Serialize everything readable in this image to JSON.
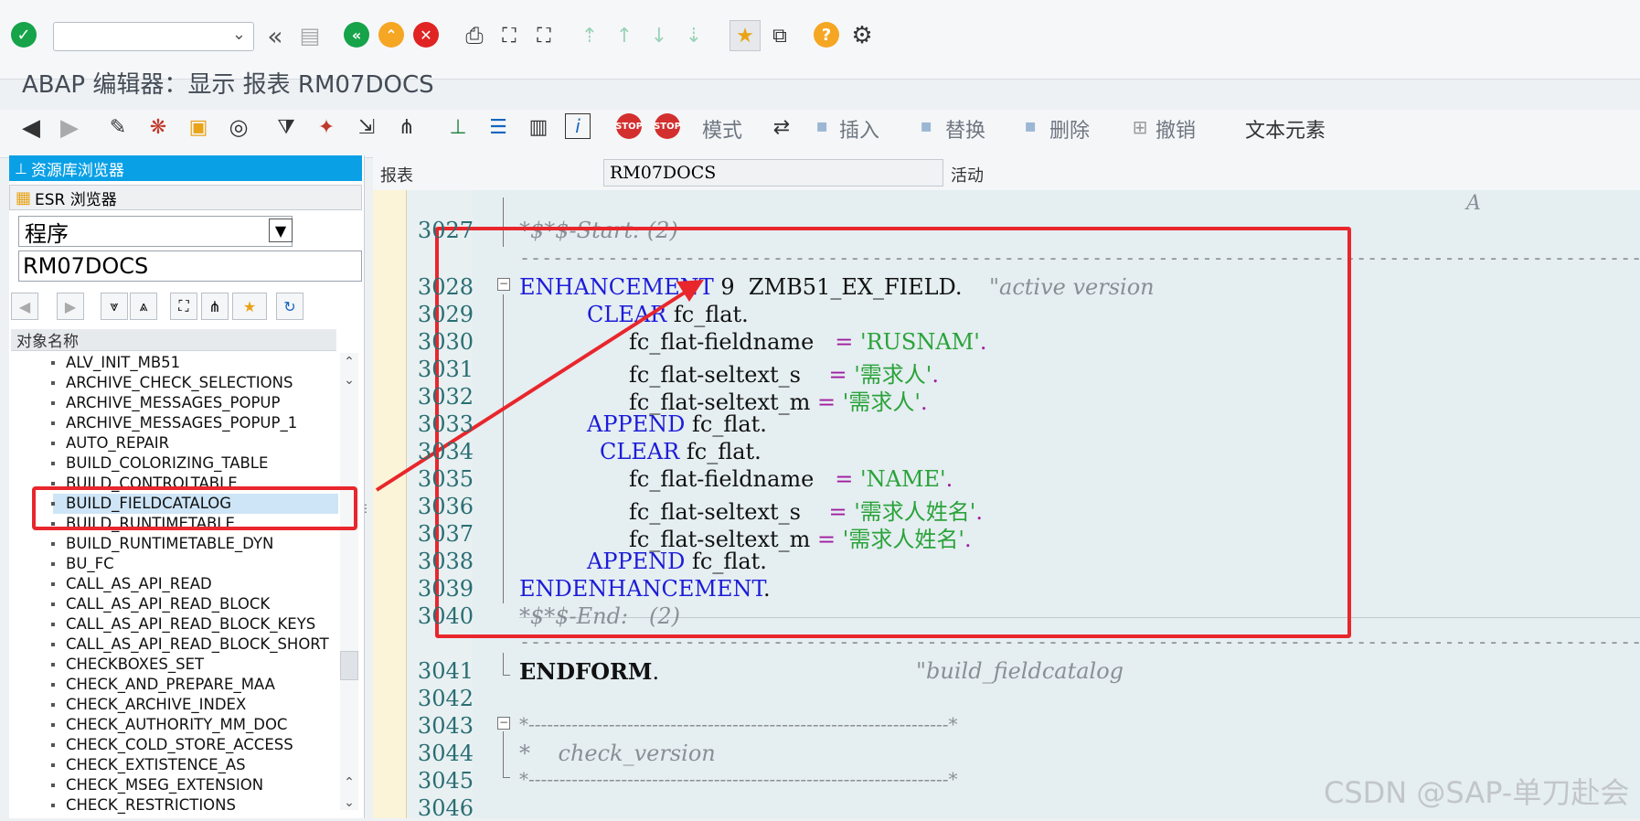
{
  "toolbar": {
    "dropdown_value": "",
    "icons": [
      "check-icon",
      "back-double-icon",
      "save-icon",
      "back-green-icon",
      "up-yellow-icon",
      "cancel-red-icon",
      "print-icon",
      "find-icon",
      "find-next-icon",
      "first-page-icon",
      "prev-page-icon",
      "next-page-icon",
      "last-page-icon",
      "new-session-icon",
      "shortcut-icon",
      "help-icon",
      "settings-gear-icon"
    ]
  },
  "title": "ABAP 编辑器：显示 报表 RM07DOCS",
  "editor_toolbar": {
    "mode_label": "模式",
    "insert_label": "插入",
    "replace_label": "替换",
    "delete_label": "删除",
    "undo_label": "撤销",
    "text_elements_label": "文本元素"
  },
  "left_panel": {
    "repository_browser": "资源库浏览器",
    "esr_browser": "ESR 浏览器",
    "object_type": "程序",
    "object_name": "RM07DOCS",
    "column_header": "对象名称",
    "items": [
      "ALV_INIT_MB51",
      "ARCHIVE_CHECK_SELECTIONS",
      "ARCHIVE_MESSAGES_POPUP",
      "ARCHIVE_MESSAGES_POPUP_1",
      "AUTO_REPAIR",
      "BUILD_COLORIZING_TABLE",
      "BUILD_CONTROLTABLE",
      "BUILD_FIELDCATALOG",
      "BUILD_RUNTIMETABLE",
      "BUILD_RUNTIMETABLE_DYN",
      "BU_FC",
      "CALL_AS_API_READ",
      "CALL_AS_API_READ_BLOCK",
      "CALL_AS_API_READ_BLOCK_KEYS",
      "CALL_AS_API_READ_BLOCK_SHORT",
      "CHECKBOXES_SET",
      "CHECK_AND_PREPARE_MAA",
      "CHECK_ARCHIVE_INDEX",
      "CHECK_AUTHORITY_MM_DOC",
      "CHECK_COLD_STORE_ACCESS",
      "CHECK_EXTISTENCE_AS",
      "CHECK_MSEG_EXTENSION",
      "CHECK_RESTRICTIONS"
    ],
    "selected_index": 7
  },
  "editor": {
    "report_label": "报表",
    "report_name": "RM07DOCS",
    "status_label": "活动",
    "col_marker": "A",
    "line_numbers": [
      "3027",
      "3028",
      "3029",
      "3030",
      "3031",
      "3032",
      "3033",
      "3034",
      "3035",
      "3036",
      "3037",
      "3038",
      "3039",
      "3040",
      "3041",
      "3042",
      "3043",
      "3044",
      "3045",
      "3046"
    ],
    "code": {
      "l3027": "*$*$-Start: (2)",
      "l3028_kw": "ENHANCEMENT",
      "l3028_rest": " 9  ZMB51_EX_FIELD.",
      "l3028_com": "\"active version",
      "clear": "CLEAR",
      "fc_flat": " fc_flat.",
      "fieldname": "fc_flat-fieldname   ",
      "seltext_s": "fc_flat-seltext_s    ",
      "seltext_m": "fc_flat-seltext_m ",
      "eq": "=",
      "rusnam": "'RUSNAM'",
      "xuqiuren": "'需求人'",
      "append": "APPEND",
      "name": "'NAME'",
      "xuqiurenxingming": "'需求人姓名'",
      "dot": ".",
      "endenhancement": "ENDENHANCEMENT",
      "l3040": "*$*$-End:   (2)",
      "endform": "ENDFORM",
      "endform_com": "\"build_fieldcatalog",
      "l3043": "*--------------------------------------------------------------------*",
      "l3044": "*    check_version",
      "l3045": "*--------------------------------------------------------------------*"
    }
  },
  "watermark": "CSDN @SAP-单刀赴会",
  "colors": {
    "keyword": "#1c1cd8",
    "string": "#2aa33a",
    "comment": "#8a8f97",
    "highlight_box": "#e8262c",
    "header_blue": "#0aa0e6"
  }
}
